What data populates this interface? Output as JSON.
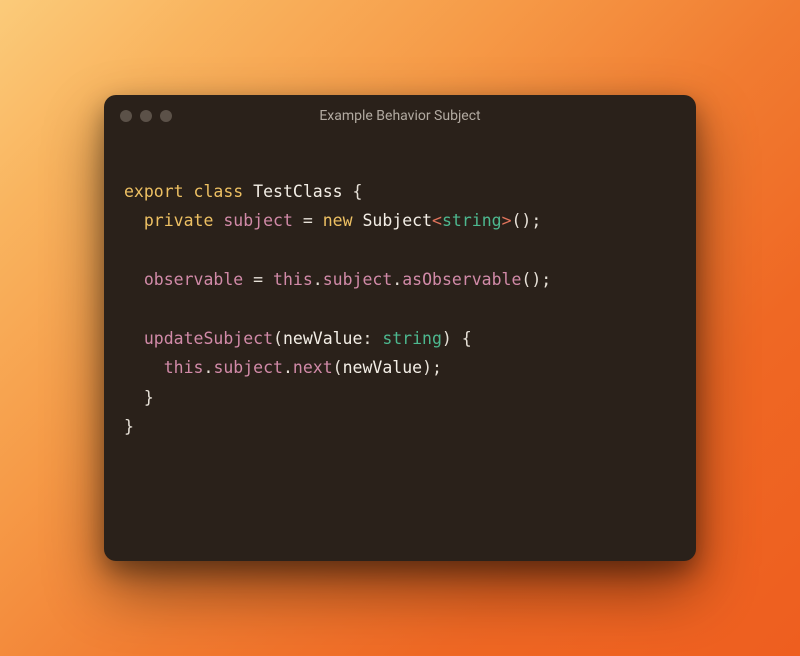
{
  "window": {
    "title": "Example Behavior Subject"
  },
  "syntax": {
    "keyword_color": "#edc063",
    "property_color": "#d18aa8",
    "type_color": "#4db88f",
    "angle_color": "#e2745c",
    "default_color": "#f4efe8"
  },
  "code": {
    "tokens": [
      [
        {
          "t": "export",
          "c": "kw"
        },
        {
          "t": " ",
          "c": ""
        },
        {
          "t": "class",
          "c": "kw"
        },
        {
          "t": " ",
          "c": ""
        },
        {
          "t": "TestClass",
          "c": "cls"
        },
        {
          "t": " ",
          "c": ""
        },
        {
          "t": "{",
          "c": "punc"
        }
      ],
      [
        {
          "t": "  ",
          "c": ""
        },
        {
          "t": "private",
          "c": "kw"
        },
        {
          "t": " ",
          "c": ""
        },
        {
          "t": "subject",
          "c": "prop"
        },
        {
          "t": " ",
          "c": ""
        },
        {
          "t": "=",
          "c": "punc"
        },
        {
          "t": " ",
          "c": ""
        },
        {
          "t": "new",
          "c": "kw"
        },
        {
          "t": " ",
          "c": ""
        },
        {
          "t": "Subject",
          "c": "cls"
        },
        {
          "t": "<",
          "c": "op"
        },
        {
          "t": "string",
          "c": "type"
        },
        {
          "t": ">",
          "c": "op"
        },
        {
          "t": "()",
          "c": "punc"
        },
        {
          "t": ";",
          "c": "punc"
        }
      ],
      [],
      [
        {
          "t": "  ",
          "c": ""
        },
        {
          "t": "observable",
          "c": "prop"
        },
        {
          "t": " ",
          "c": ""
        },
        {
          "t": "=",
          "c": "punc"
        },
        {
          "t": " ",
          "c": ""
        },
        {
          "t": "this",
          "c": "prop"
        },
        {
          "t": ".",
          "c": "punc"
        },
        {
          "t": "subject",
          "c": "prop"
        },
        {
          "t": ".",
          "c": "punc"
        },
        {
          "t": "asObservable",
          "c": "fn"
        },
        {
          "t": "()",
          "c": "punc"
        },
        {
          "t": ";",
          "c": "punc"
        }
      ],
      [],
      [
        {
          "t": "  ",
          "c": ""
        },
        {
          "t": "updateSubject",
          "c": "fn"
        },
        {
          "t": "(",
          "c": "punc"
        },
        {
          "t": "newValue",
          "c": "var"
        },
        {
          "t": ":",
          "c": "punc"
        },
        {
          "t": " ",
          "c": ""
        },
        {
          "t": "string",
          "c": "type"
        },
        {
          "t": ")",
          "c": "punc"
        },
        {
          "t": " ",
          "c": ""
        },
        {
          "t": "{",
          "c": "punc"
        }
      ],
      [
        {
          "t": "    ",
          "c": ""
        },
        {
          "t": "this",
          "c": "prop"
        },
        {
          "t": ".",
          "c": "punc"
        },
        {
          "t": "subject",
          "c": "prop"
        },
        {
          "t": ".",
          "c": "punc"
        },
        {
          "t": "next",
          "c": "fn"
        },
        {
          "t": "(",
          "c": "punc"
        },
        {
          "t": "newValue",
          "c": "var"
        },
        {
          "t": ")",
          "c": "punc"
        },
        {
          "t": ";",
          "c": "punc"
        }
      ],
      [
        {
          "t": "  ",
          "c": ""
        },
        {
          "t": "}",
          "c": "punc"
        }
      ],
      [
        {
          "t": "}",
          "c": "punc"
        }
      ]
    ]
  }
}
